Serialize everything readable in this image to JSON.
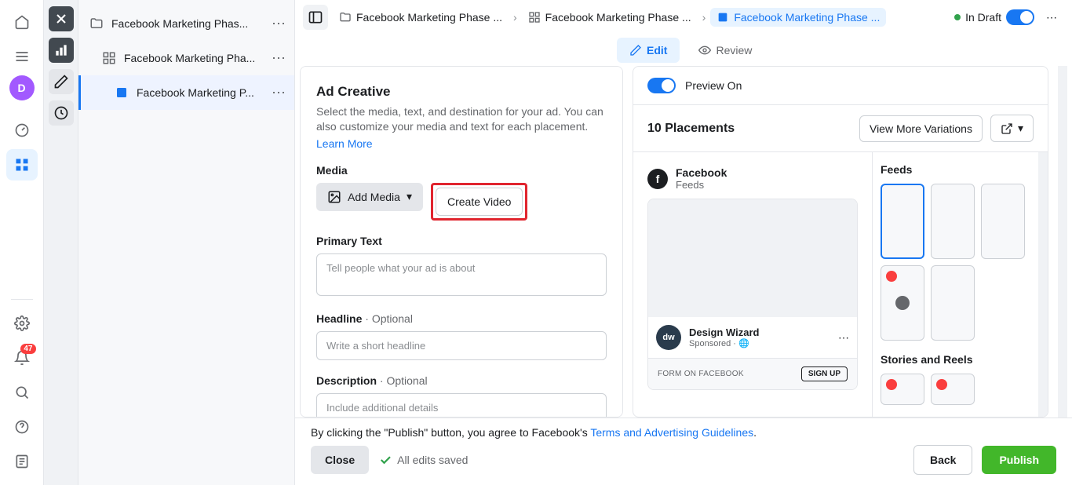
{
  "rail": {
    "avatar_letter": "D",
    "badge": "47"
  },
  "tree": {
    "items": [
      {
        "label": "Facebook Marketing Phas..."
      },
      {
        "label": "Facebook Marketing Pha..."
      },
      {
        "label": "Facebook Marketing P..."
      }
    ]
  },
  "breadcrumbs": [
    {
      "label": "Facebook Marketing Phase ..."
    },
    {
      "label": "Facebook Marketing Phase ..."
    },
    {
      "label": "Facebook Marketing Phase ..."
    }
  ],
  "status": {
    "label": "In Draft"
  },
  "tabs": {
    "edit": "Edit",
    "review": "Review"
  },
  "creative": {
    "heading": "Ad Creative",
    "sub": "Select the media, text, and destination for your ad. You can also customize your media and text for each placement.",
    "learn_more": "Learn More",
    "media_label": "Media",
    "add_media": "Add Media",
    "create_video": "Create Video",
    "primary_label": "Primary Text",
    "primary_ph": "Tell people what your ad is about",
    "headline_label": "Headline",
    "optional": "Optional",
    "headline_ph": "Write a short headline",
    "desc_label": "Description",
    "desc_ph": "Include additional details"
  },
  "preview": {
    "toggle_label": "Preview On",
    "placements": "10 Placements",
    "view_more": "View More Variations",
    "fb": "Facebook",
    "feeds": "Feeds",
    "advertiser": "Design Wizard",
    "sponsored": "Sponsored",
    "form_text": "FORM ON FACEBOOK",
    "signup": "SIGN UP",
    "side_feeds": "Feeds",
    "side_stories": "Stories and Reels"
  },
  "footer": {
    "disclaimer_a": "By clicking the \"Publish\" button, you agree to Facebook's ",
    "disclaimer_b": "Terms and Advertising Guidelines",
    "close": "Close",
    "saved": "All edits saved",
    "back": "Back",
    "publish": "Publish"
  }
}
